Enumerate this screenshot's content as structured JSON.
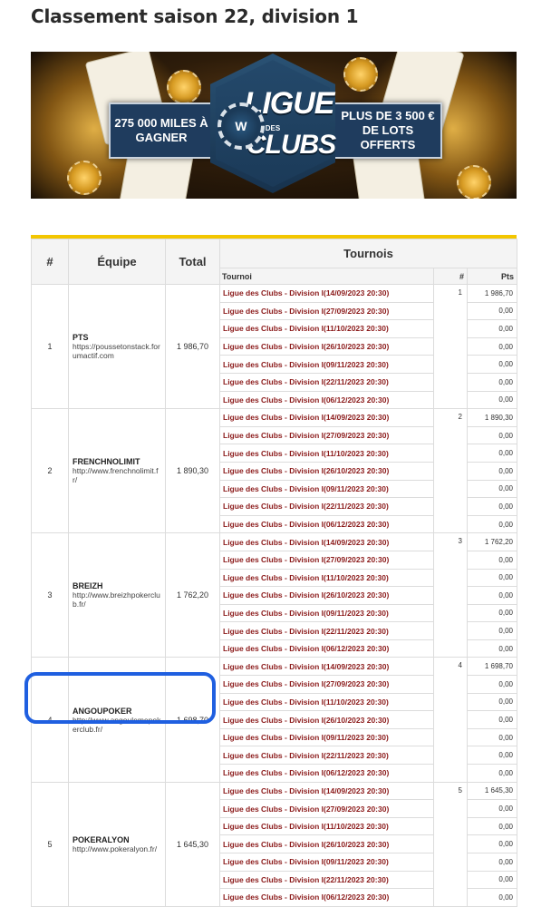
{
  "page": {
    "title": "Classement saison 22, division 1"
  },
  "banner": {
    "left_text": "275 000 MILES À\nGAGNER",
    "right_text": "PLUS DE 3 500 €\nDE LOTS OFFERTS",
    "logo_top": "LIGUE",
    "logo_mid": "DES",
    "logo_bottom": "CLUBS",
    "logo_chip": "W",
    "colors": {
      "panel": "#1f3c5e",
      "logo": "#24496b"
    }
  },
  "table": {
    "accent_color": "#f3c600",
    "headers": {
      "rank": "#",
      "team": "Équipe",
      "total": "Total",
      "tournaments": "Tournois"
    },
    "sub_headers": {
      "tournament": "Tournoi",
      "count": "#",
      "points": "Pts"
    },
    "tournament_names": [
      "Ligue des Clubs - Division I(14/09/2023 20:30)",
      "Ligue des Clubs - Division I(27/09/2023 20:30)",
      "Ligue des Clubs - Division I(11/10/2023 20:30)",
      "Ligue des Clubs - Division I(26/10/2023 20:30)",
      "Ligue des Clubs - Division I(09/11/2023 20:30)",
      "Ligue des Clubs - Division I(22/11/2023 20:30)",
      "Ligue des Clubs - Division I(06/12/2023 20:30)"
    ],
    "teams": [
      {
        "rank": "1",
        "name": "PTS",
        "url": "https://poussetonstack.forumactif.com",
        "total": "1 986,70",
        "count": "1",
        "points": [
          "1 986,70",
          "0,00",
          "0,00",
          "0,00",
          "0,00",
          "0,00",
          "0,00"
        ]
      },
      {
        "rank": "2",
        "name": "FRENCHNOLIMIT",
        "url": "http://www.frenchnolimit.fr/",
        "total": "1 890,30",
        "count": "2",
        "points": [
          "1 890,30",
          "0,00",
          "0,00",
          "0,00",
          "0,00",
          "0,00",
          "0,00"
        ]
      },
      {
        "rank": "3",
        "name": "BREIZH",
        "url": "http://www.breizhpokerclub.fr/",
        "total": "1 762,20",
        "count": "3",
        "points": [
          "1 762,20",
          "0,00",
          "0,00",
          "0,00",
          "0,00",
          "0,00",
          "0,00"
        ]
      },
      {
        "rank": "4",
        "name": "ANGOUPOKER",
        "url": "http://www.angoulemepokerclub.fr/",
        "total": "1 698,70",
        "count": "4",
        "points": [
          "1 698,70",
          "0,00",
          "0,00",
          "0,00",
          "0,00",
          "0,00",
          "0,00"
        ]
      },
      {
        "rank": "5",
        "name": "POKERALYON",
        "url": "http://www.pokeralyon.fr/",
        "total": "1 645,30",
        "count": "5",
        "points": [
          "1 645,30",
          "0,00",
          "0,00",
          "0,00",
          "0,00",
          "0,00",
          "0,00"
        ]
      }
    ]
  },
  "highlight": {
    "color": "#1f5fe0",
    "team_rank": "4"
  }
}
